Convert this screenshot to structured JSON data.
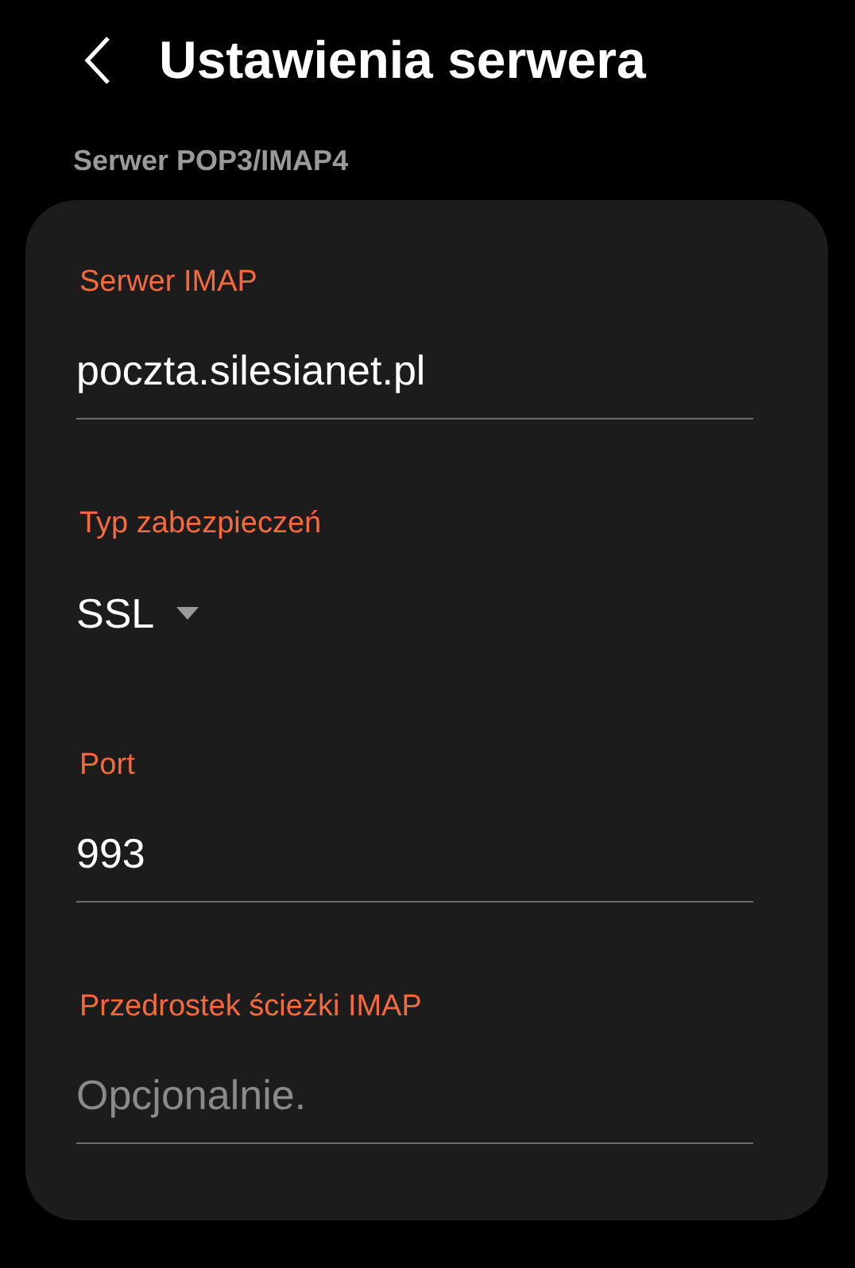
{
  "header": {
    "title": "Ustawienia serwera"
  },
  "section": {
    "label": "Serwer POP3/IMAP4"
  },
  "fields": [
    {
      "kind": "input",
      "label": "Serwer IMAP",
      "value": "poczta.silesianet.pl"
    },
    {
      "kind": "dropdown",
      "label": "Typ zabezpieczeń",
      "value": "SSL"
    },
    {
      "kind": "input",
      "label": "Port",
      "value": "993"
    },
    {
      "kind": "input",
      "label": "Przedrostek ścieżki IMAP",
      "placeholder": "Opcjonalnie."
    }
  ]
}
